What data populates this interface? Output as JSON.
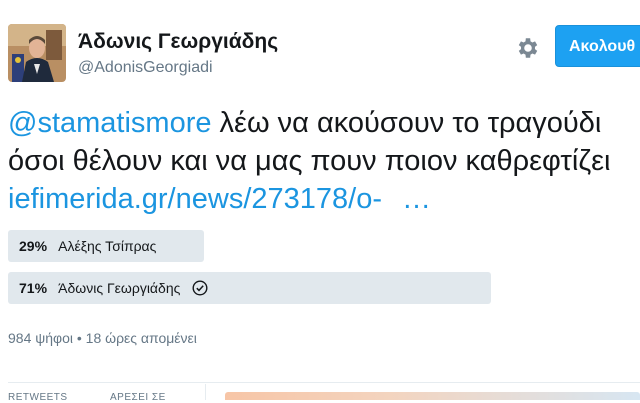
{
  "profile": {
    "name": "Άδωνις Γεωργιάδης",
    "handle": "@AdonisGeorgiadi",
    "avatar_icon": "user-avatar-photo"
  },
  "actions": {
    "settings_icon": "gear-icon",
    "follow_label": "Ακολουθ"
  },
  "tweet": {
    "mention": "@stamatismore",
    "line1_rest": " λέω να ακούσουν το τραγούδι",
    "line2": "όσοι θέλουν και να μας πουν ποιον καθρεφτίζει",
    "link": "iefimerida.gr/news/273178/o-",
    "ellipsis": "…"
  },
  "poll": {
    "choices": [
      {
        "percent": "29%",
        "label": "Αλέξης Τσίπρας",
        "fraction": 0.29,
        "selected": false
      },
      {
        "percent": "71%",
        "label": "Άδωνις Γεωργιάδης",
        "fraction": 0.71,
        "selected": true
      }
    ],
    "meta": "984 ψήφοι • 18 ώρες απομένει"
  },
  "stats": {
    "retweets_label": "RETWEETS",
    "likes_label": "ΑΡΕΣΕΙ ΣΕ"
  },
  "colors": {
    "accent": "#1da1f2",
    "link": "#1b95e0",
    "poll_bar": "#e1e8ed",
    "muted": "#657786"
  }
}
